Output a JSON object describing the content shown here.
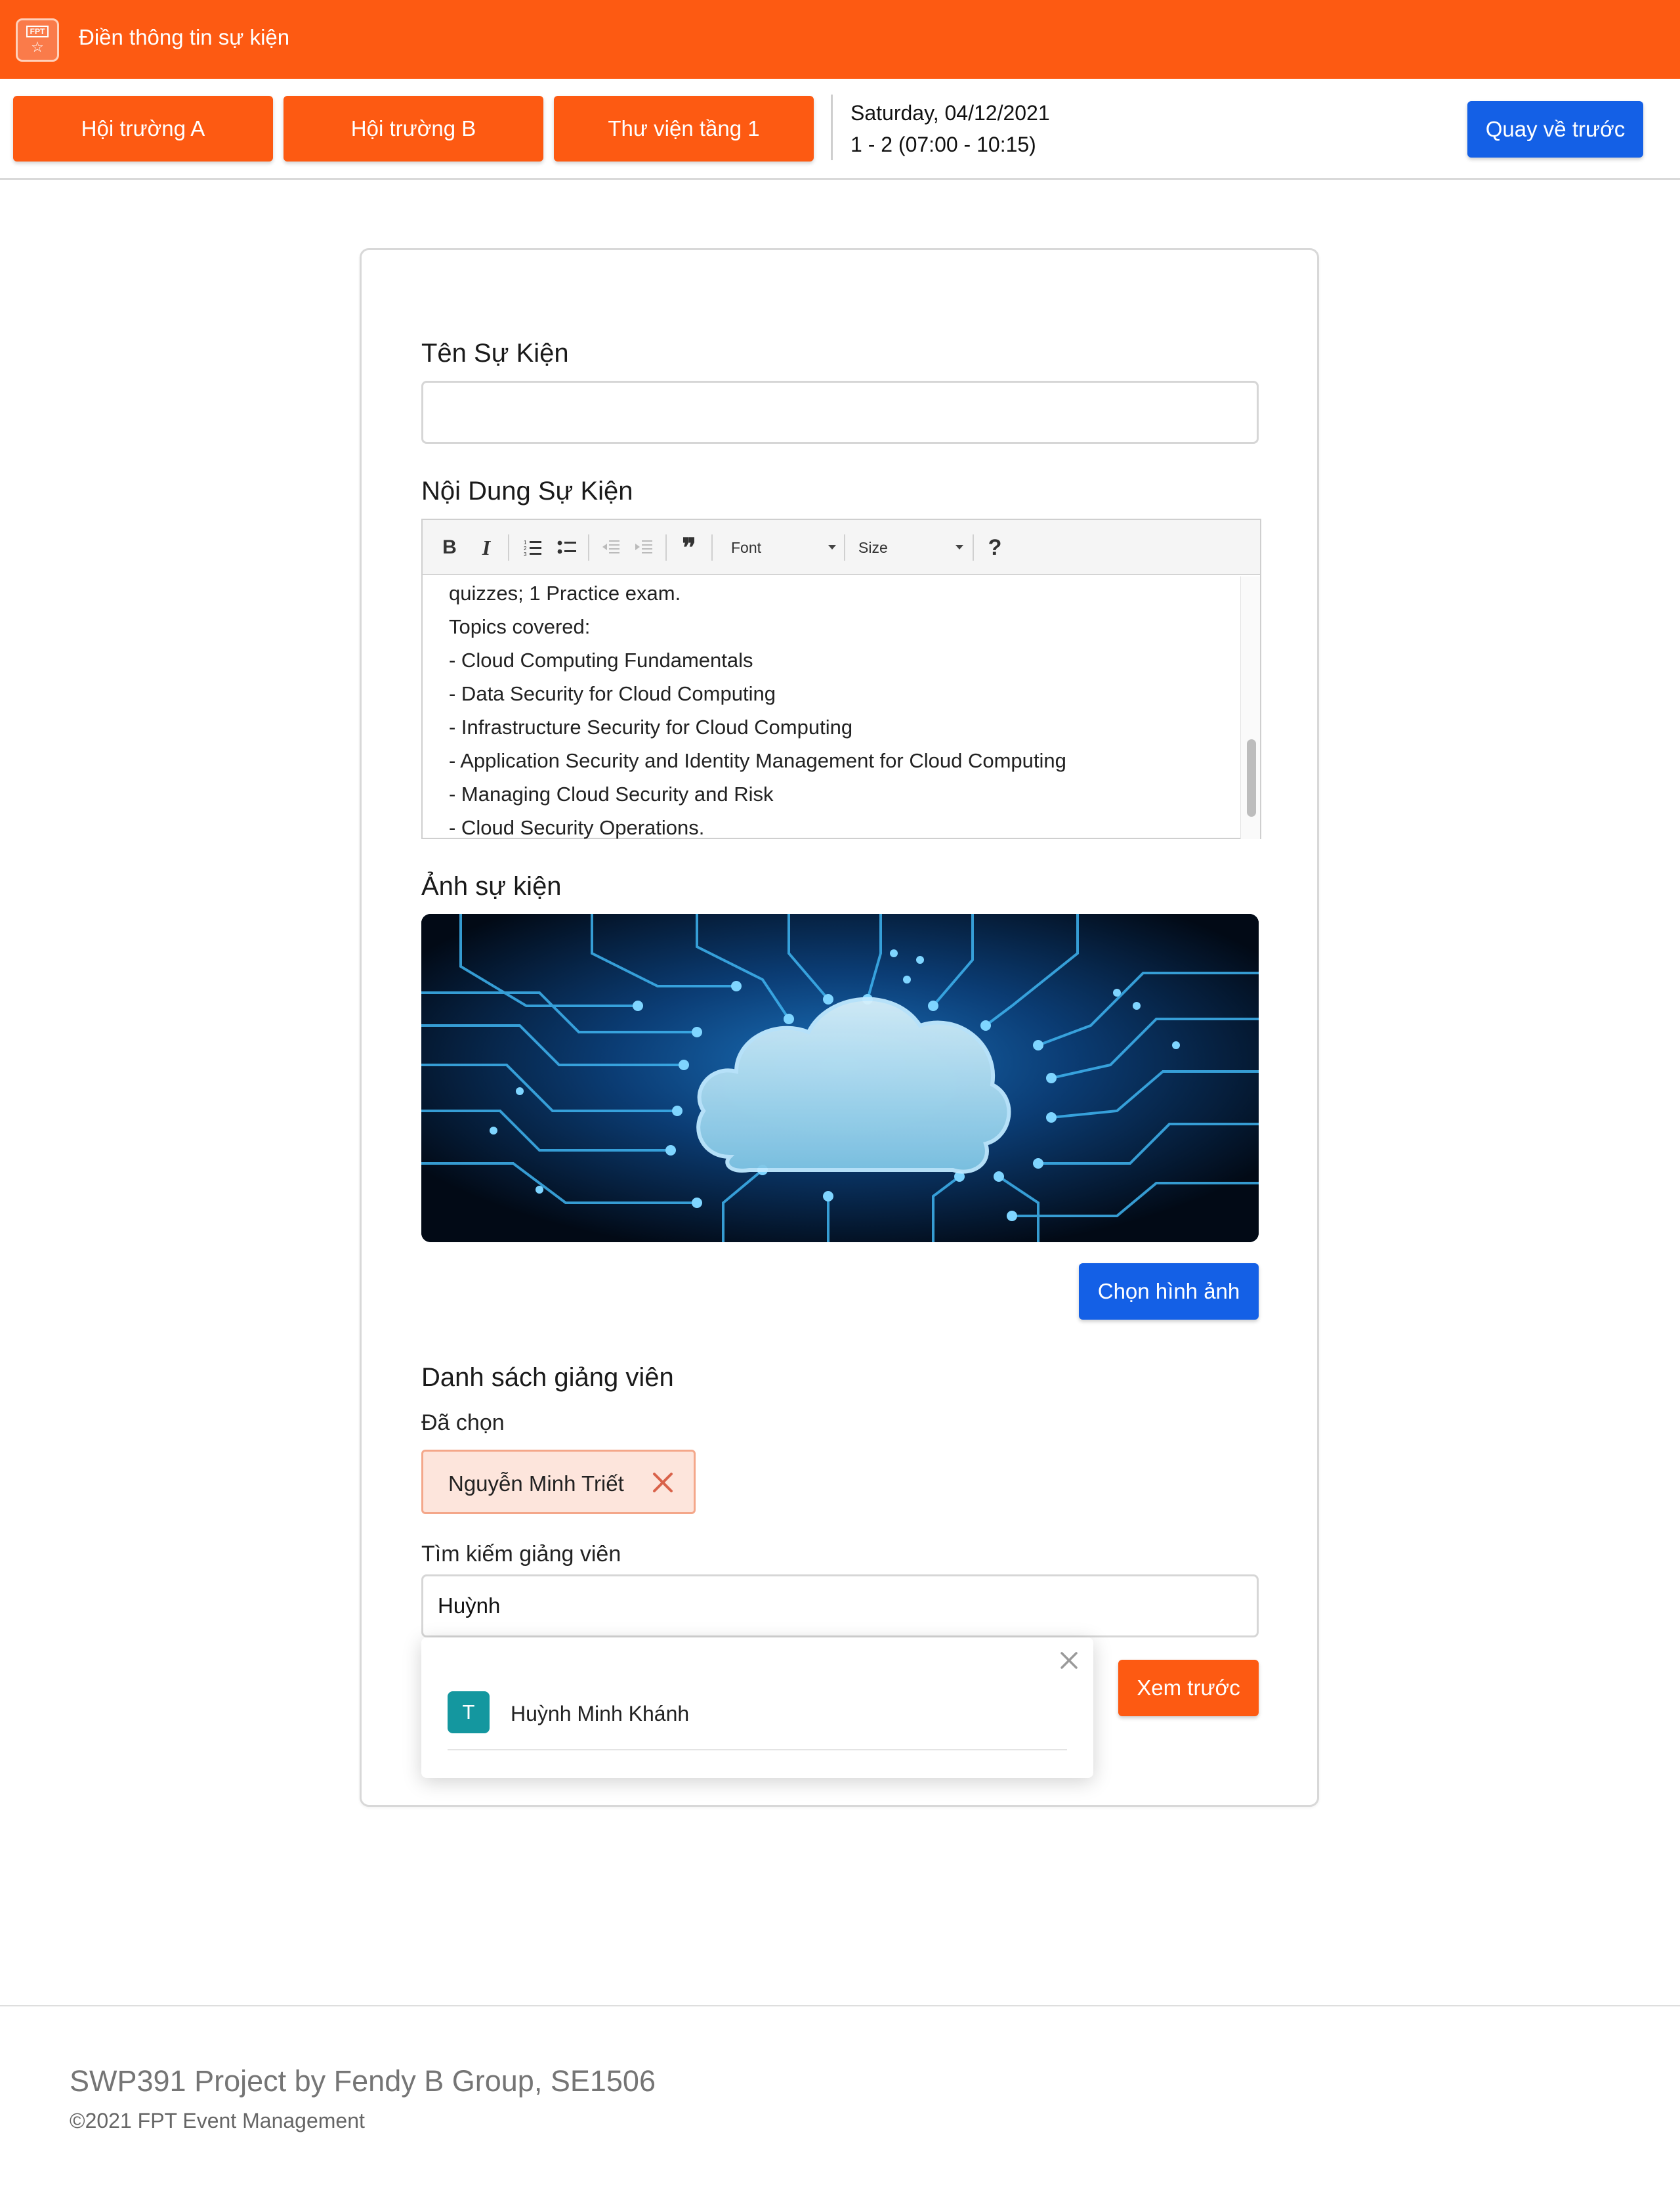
{
  "header": {
    "title": "Điền thông tin sự kiện",
    "logo_icon": "fpt-logo-icon",
    "logo_text": "FPT",
    "color": "#fd5a12"
  },
  "rooms": [
    "Hội trường A",
    "Hội trường B",
    "Thư viện tầng 1"
  ],
  "schedule": {
    "date": "Saturday, 04/12/2021",
    "slot": "1 - 2 (07:00 - 10:15)"
  },
  "back_button": "Quay về trước",
  "form": {
    "name_label": "Tên Sự Kiện",
    "name_value": "",
    "content_label": "Nội Dung Sự Kiện",
    "toolbar": {
      "bold": "B",
      "italic": "I",
      "quote": "❞",
      "font": "Font",
      "size": "Size",
      "help": "?"
    },
    "content_lines": [
      "quizzes; 1 Practice exam.",
      "Topics covered:",
      "- Cloud Computing Fundamentals",
      "- Data Security for Cloud Computing",
      "- Infrastructure Security for Cloud Computing",
      "- Application Security and Identity Management for Cloud Computing",
      "- Managing Cloud Security and Risk",
      "- Cloud Security Operations."
    ],
    "image_label": "Ảnh sự kiện",
    "choose_image_button": "Chọn hình ảnh",
    "lecturers_label": "Danh sách giảng viên",
    "selected_label": "Đã chọn",
    "selected": [
      "Nguyễn Minh Triết"
    ],
    "search_label": "Tìm kiếm giảng viên",
    "search_value": "Huỳnh",
    "suggestions": [
      {
        "initial": "T",
        "name": "Huỳnh Minh Khánh"
      }
    ],
    "preview_button": "Xem trước"
  },
  "footer": {
    "title": "SWP391 Project by Fendy B Group, SE1506",
    "copyright": "©2021 FPT Event Management"
  },
  "colors": {
    "orange": "#fd5a12",
    "blue": "#1460e6",
    "teal": "#14979f"
  }
}
